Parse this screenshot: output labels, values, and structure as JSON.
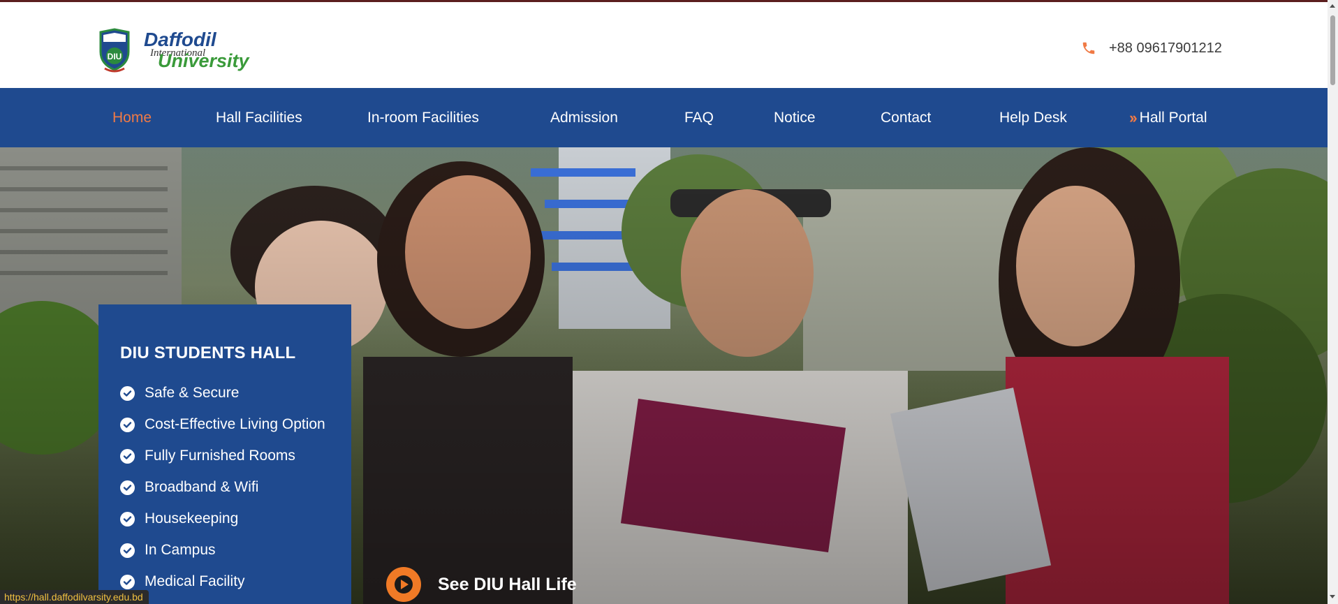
{
  "header": {
    "logo": {
      "line1": "Daffodil",
      "line2": "International",
      "line3": "University",
      "crest": "DIU"
    },
    "phone": {
      "icon": "phone-icon",
      "number": "+88 09617901212"
    }
  },
  "nav": {
    "items": [
      {
        "label": "Home",
        "active": true
      },
      {
        "label": "Hall Facilities"
      },
      {
        "label": "In-room Facilities"
      },
      {
        "label": "Admission"
      },
      {
        "label": "FAQ"
      },
      {
        "label": "Notice"
      },
      {
        "label": "Contact"
      },
      {
        "label": "Help Desk"
      },
      {
        "label": "Hall Portal",
        "icon": "double-chevron-right-icon"
      }
    ]
  },
  "hero": {
    "panel": {
      "title": "DIU STUDENTS HALL",
      "features": [
        "Safe & Secure",
        "Cost-Effective Living Option",
        "Fully Furnished Rooms",
        "Broadband & Wifi",
        "Housekeeping",
        "In Campus",
        "Medical Facility"
      ]
    },
    "cta": {
      "label": "See DIU Hall Life",
      "icon": "play-icon"
    }
  },
  "status_url": "https://hall.daffodilvarsity.edu.bd",
  "colors": {
    "nav_bg": "#1f4a8f",
    "accent": "#f07a45",
    "cta": "#f07a26"
  }
}
